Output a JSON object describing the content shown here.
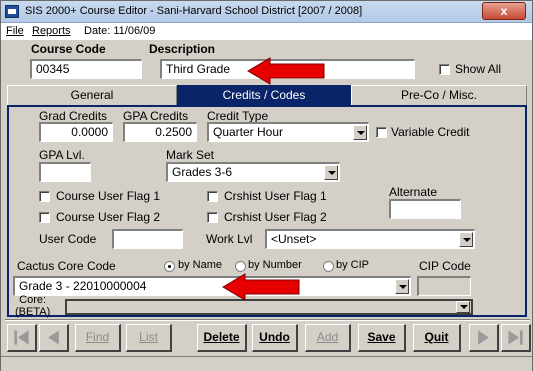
{
  "window": {
    "title": "SIS 2000+   Course Editor - Sani-Harvard School District [2007 / 2008]",
    "close_label": "x"
  },
  "menubar": {
    "file": "File",
    "reports": "Reports",
    "date_label": "Date: 11/06/09"
  },
  "course": {
    "code_label": "Course Code",
    "code_value": "00345",
    "description_label": "Description",
    "description_value": "Third Grade",
    "show_all_label": "Show All"
  },
  "tabs": [
    {
      "label": "General",
      "active": false
    },
    {
      "label": "Credits / Codes",
      "active": true
    },
    {
      "label": "Pre-Co / Misc.",
      "active": false
    }
  ],
  "credits": {
    "grad_credits_label": "Grad Credits",
    "grad_credits_value": "0.0000",
    "gpa_credits_label": "GPA Credits",
    "gpa_credits_value": "0.2500",
    "credit_type_label": "Credit Type",
    "credit_type_value": "Quarter Hour",
    "variable_credit_label": "Variable Credit",
    "gpa_lvl_label": "GPA Lvl.",
    "gpa_lvl_value": "",
    "mark_set_label": "Mark Set",
    "mark_set_value": "Grades 3-6",
    "course_user_flag_1": "Course User Flag 1",
    "crshist_user_flag_1": "Crshist User Flag 1",
    "alternate_label": "Alternate",
    "alternate_value": "",
    "course_user_flag_2": "Course User Flag 2",
    "crshist_user_flag_2": "Crshist User Flag 2",
    "user_code_label": "User Code",
    "user_code_value": "",
    "work_lvl_label": "Work Lvl",
    "work_lvl_value": "<Unset>"
  },
  "cactus": {
    "label": "Cactus Core Code",
    "radio_by_name": "by Name",
    "radio_by_number": "by Number",
    "radio_by_cip": "by CIP",
    "cip_code_label": "CIP Code",
    "core_code_value": "Grade 3 - 22010000004",
    "cip_code_value": "",
    "core_beta_label": "Core:\n(BETA)",
    "core_beta_value": ""
  },
  "toolbar": {
    "find": "Find",
    "list": "List",
    "delete": "Delete",
    "undo": "Undo",
    "add": "Add",
    "save": "Save",
    "quit": "Quit"
  },
  "colors": {
    "active_tab": "#0a246a",
    "annotation_arrow": "#e60000"
  }
}
